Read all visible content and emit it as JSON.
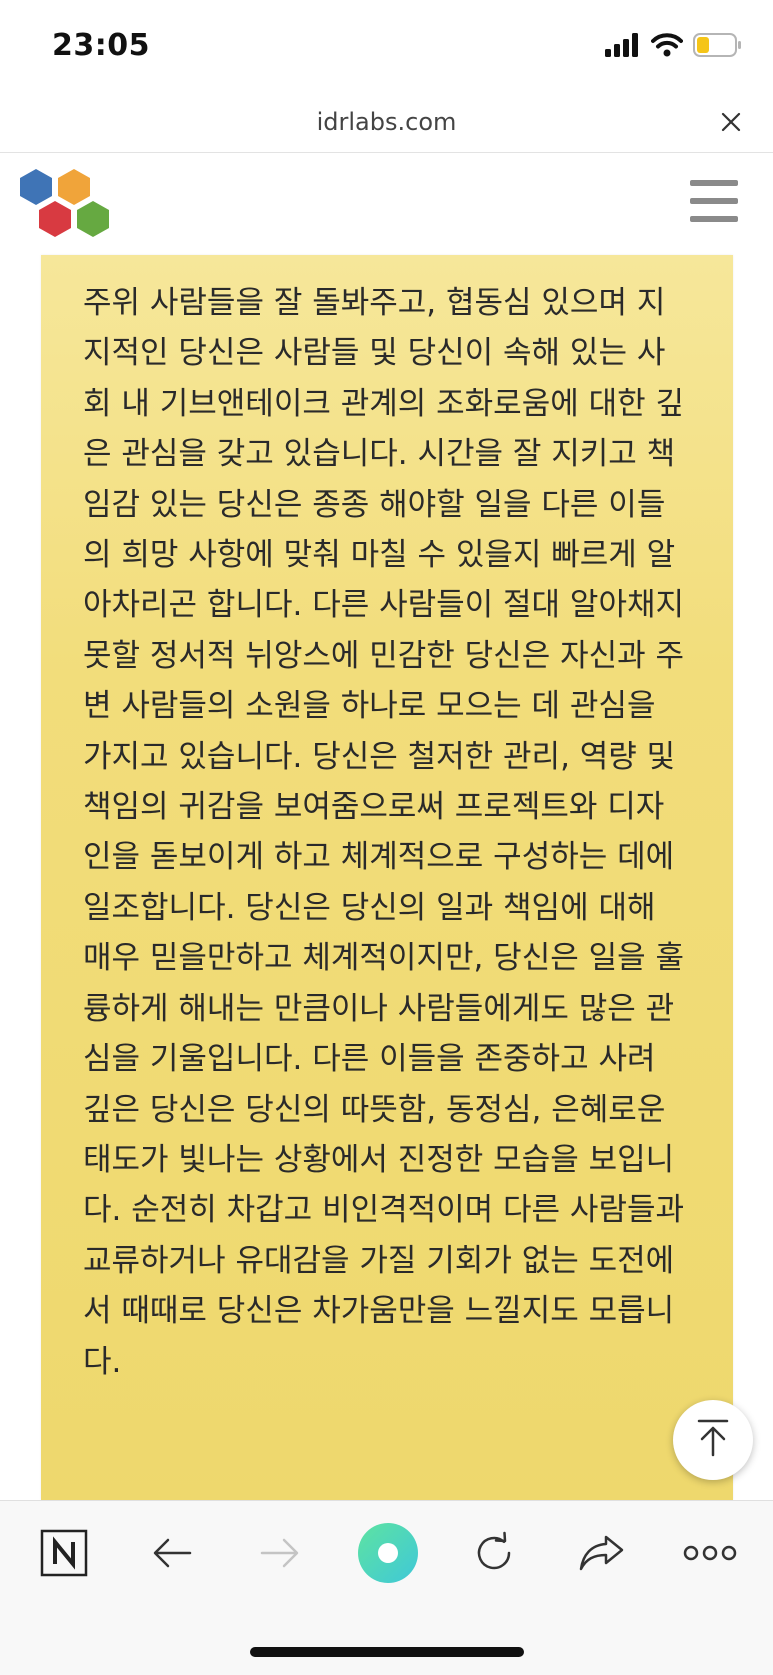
{
  "status_bar": {
    "time": "23:05"
  },
  "browser": {
    "url": "idrlabs.com"
  },
  "content": {
    "paragraph": "주위 사람들을 잘 돌봐주고, 협동심 있으며 지지적인 당신은 사람들 및 당신이 속해 있는 사회 내 기브앤테이크 관계의 조화로움에 대한 깊은 관심을 갖고 있습니다. 시간을 잘 지키고 책임감 있는 당신은 종종 해야할 일을 다른 이들의 희망 사항에 맞춰 마칠 수 있을지 빠르게 알아차리곤 합니다. 다른 사람들이 절대 알아채지 못할 정서적 뉘앙스에 민감한 당신은 자신과 주변 사람들의 소원을 하나로 모으는 데 관심을 가지고 있습니다. 당신은 철저한 관리, 역량 및 책임의 귀감을 보여줌으로써 프로젝트와 디자인을 돋보이게 하고 체계적으로 구성하는 데에 일조합니다. 당신은 당신의 일과 책임에 대해 매우 믿을만하고 체계적이지만, 당신은 일을 훌륭하게 해내는 만큼이나 사람들에게도 많은 관심을 기울입니다. 다른 이들을 존중하고 사려 깊은 당신은 당신의 따뜻함, 동정심, 은혜로운 태도가 빛나는 상황에서 진정한 모습을 보입니다. 순전히 차갑고 비인격적이며 다른 사람들과 교류하거나 유대감을 가질 기회가 없는 도전에서 때때로 당신은 차가움만을 느낄지도 모릅니다."
  },
  "icons": {
    "signal": "signal-icon",
    "wifi": "wifi-icon",
    "battery": "battery-icon",
    "close": "close-icon",
    "logo": "hexagon-logo-icon",
    "menu": "hamburger-menu-icon",
    "scroll_top": "scroll-to-top-icon",
    "toolbar": [
      "n-app-icon",
      "back-arrow-icon",
      "forward-arrow-icon",
      "home-circle-icon",
      "reload-icon",
      "share-icon",
      "more-dots-icon"
    ]
  },
  "colors": {
    "card_bg": "#f2dd7b",
    "battery_level": "#f5c518",
    "logo_blue": "#3f74b6",
    "logo_orange": "#f0a43a",
    "logo_red": "#d83a41",
    "logo_green": "#66a941",
    "home_button_gradient": [
      "#5ee3a1",
      "#3fc8d8"
    ]
  }
}
